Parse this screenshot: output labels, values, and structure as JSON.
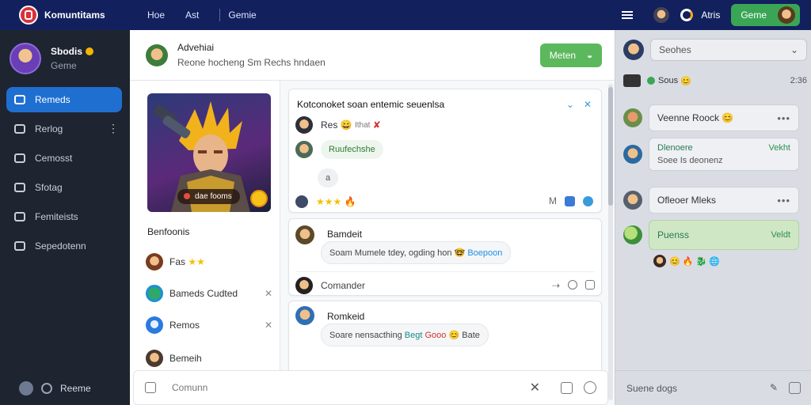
{
  "topbar": {
    "app_title": "Komuntitams",
    "nav": [
      "Hoe",
      "Ast",
      "Gemie"
    ],
    "user_label": "Atris",
    "game_button": "Geme"
  },
  "leftnav": {
    "profile_name": "Sbodis",
    "profile_sub": "Geme",
    "items": [
      {
        "label": "Remeds",
        "icon": "home-icon"
      },
      {
        "label": "Rerlog",
        "icon": "people-icon"
      },
      {
        "label": "Cemosst",
        "icon": "chat-icon"
      },
      {
        "label": "Sfotag",
        "icon": "calendar-icon"
      },
      {
        "label": "Femiteists",
        "icon": "tag-icon"
      },
      {
        "label": "Sepedotenn",
        "icon": "bag-icon"
      }
    ],
    "footer_label": "Reeme"
  },
  "chat_header": {
    "title": "Advehiai",
    "subtitle": "Reone hocheng Sm Rechs hndaen",
    "join_button": "Meten"
  },
  "game": {
    "art_chip": "dae fooms",
    "section_title": "Benfoonis",
    "friends": [
      {
        "label": "Fas",
        "stars": "★★"
      },
      {
        "label": "Bameds Cudted"
      },
      {
        "label": "Remos"
      },
      {
        "label": "Bemeih"
      }
    ]
  },
  "feed": {
    "card1": {
      "title": "Kotconoket soan entemic seuenlsa",
      "row1": "Res",
      "row1_extra": "Ithat",
      "row2": "Ruufechshe",
      "row3": "a",
      "stars": "★★★",
      "foot_letter": "M"
    },
    "card2": {
      "author": "Bamdeit",
      "text": "Soam Mumele tdey, ogding hon",
      "link": "Boepoon",
      "comment_label": "Comander"
    },
    "card3": {
      "author": "Romkeid",
      "text": "Soare nensacthing",
      "blue": "Begt",
      "red": "Gooo",
      "end": "Bate"
    }
  },
  "composer": {
    "placeholder": "Comunn"
  },
  "rightpanel": {
    "search_placeholder": "Seohes",
    "status_label": "Sous",
    "status_time": "2:36",
    "items": [
      {
        "label": "Veenne Roock"
      },
      {
        "label": "Dlenoere",
        "sub": "Soee Is deonenz",
        "tag": "Vekht"
      },
      {
        "label": "Ofleoer Mleks"
      },
      {
        "label": "Puenss",
        "tag": "Veldt"
      }
    ],
    "footer_label": "Suene dogs"
  },
  "colors": {
    "topbar": "#12205e",
    "accent_blue": "#1f6fd1",
    "accent_green": "#3aa655"
  }
}
